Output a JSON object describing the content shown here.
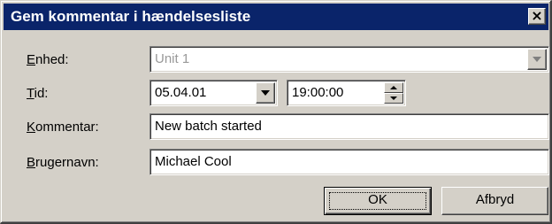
{
  "window": {
    "title": "Gem kommentar i hændelsesliste",
    "close_glyph": "×"
  },
  "form": {
    "unit": {
      "label_key": "E",
      "label_rest": "nhed:",
      "value": "Unit 1",
      "disabled": true
    },
    "time": {
      "label_key": "T",
      "label_rest": "id:",
      "date_value": "05.04.01",
      "time_value": "19:00:00"
    },
    "comment": {
      "label_key": "K",
      "label_rest": "ommentar:",
      "value": "New batch started"
    },
    "username": {
      "label_key": "B",
      "label_rest": "rugernavn:",
      "value": "Michael Cool"
    }
  },
  "buttons": {
    "ok_label": "OK",
    "cancel_label": "Afbryd"
  },
  "colors": {
    "titlebar": "#0a246a",
    "face": "#d4d0c8",
    "disabled_text": "#999999"
  },
  "icons": {
    "close": "close-icon",
    "dropdown": "chevron-down-icon",
    "spin_up": "spin-up-icon",
    "spin_down": "spin-down-icon"
  }
}
